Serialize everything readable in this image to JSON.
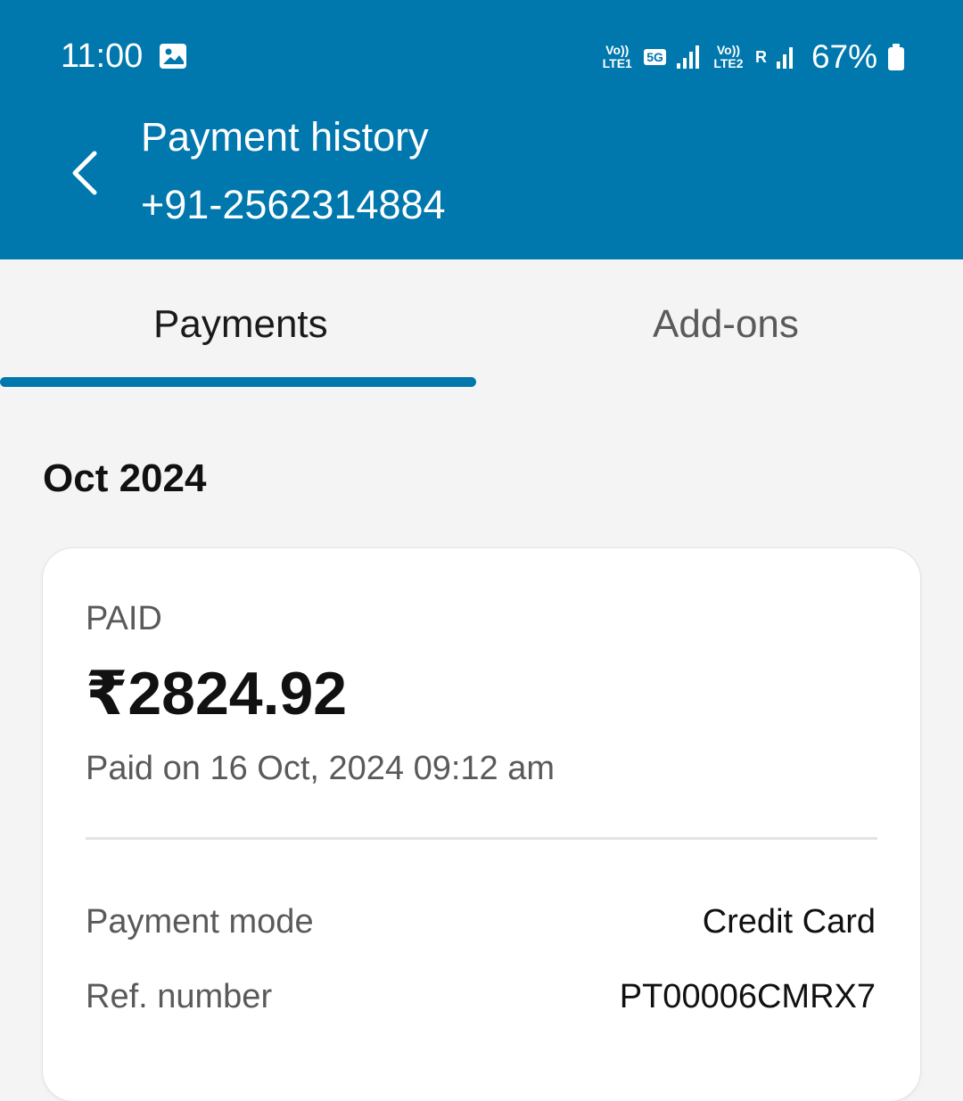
{
  "status_bar": {
    "time": "11:00",
    "network_1": "Vo)) LTE1",
    "network_5g": "5G",
    "network_2": "Vo)) LTE2",
    "roaming": "R",
    "battery": "67%",
    "icons": [
      "gallery-icon",
      "signal-icon",
      "battery-icon"
    ]
  },
  "header": {
    "title": "Payment history",
    "subtitle": "+91-2562314884",
    "background_color": "#0077ad"
  },
  "tabs": [
    {
      "label": "Payments",
      "active": true
    },
    {
      "label": "Add-ons",
      "active": false
    }
  ],
  "month_heading": "Oct 2024",
  "payment": {
    "status": "PAID",
    "amount": "₹2824.92",
    "paid_on": "Paid on 16 Oct, 2024 09:12 am",
    "details": [
      {
        "label": "Payment mode",
        "value": "Credit Card"
      },
      {
        "label": "Ref. number",
        "value": "PT00006CMRX7"
      }
    ]
  }
}
